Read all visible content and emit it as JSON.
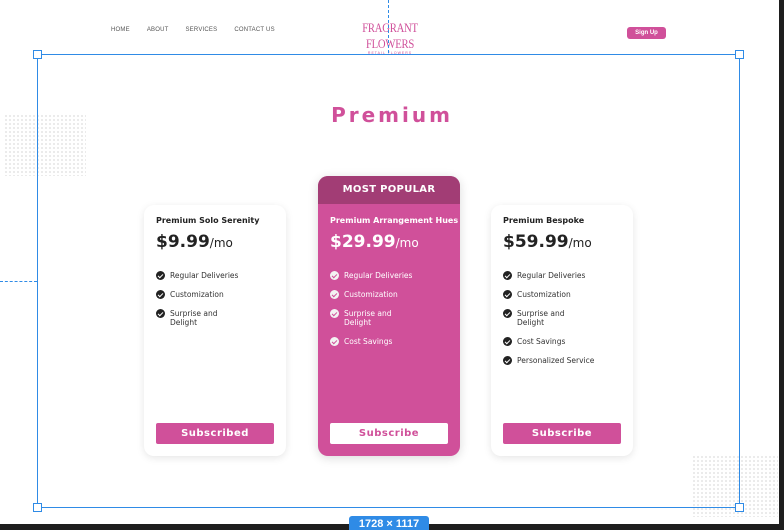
{
  "nav": {
    "items": [
      "HOME",
      "ABOUT",
      "SERVICES",
      "CONTACT US"
    ],
    "logo_main": "FRAGRANT FLOWERS",
    "logo_sub": "RETAIL FLOWERS",
    "signup_label": "Sign Up"
  },
  "canvas": {
    "dimension_label": "1728 × 1117"
  },
  "pricing": {
    "title": "Premium",
    "plans": [
      {
        "name": "Premium Solo Serenity",
        "price": "$9.99",
        "period": "/mo",
        "features": [
          "Regular Deliveries",
          "Customization",
          "Surprise and\nDelight"
        ],
        "button": "Subscribed",
        "featured": false
      },
      {
        "badge": "MOST POPULAR",
        "name": "Premium Arrangement Hues",
        "price": "$29.99",
        "period": "/mo",
        "features": [
          "Regular Deliveries",
          "Customization",
          "Surprise and\nDelight",
          "Cost Savings"
        ],
        "button": "Subscribe",
        "featured": true
      },
      {
        "name": "Premium Bespoke",
        "price": "$59.99",
        "period": "/mo",
        "features": [
          "Regular Deliveries",
          "Customization",
          "Surprise and\nDelight",
          "Cost Savings",
          "Personalized Service"
        ],
        "button": "Subscribe",
        "featured": false
      }
    ]
  },
  "colors": {
    "accent": "#d0509a",
    "badge": "#a23d75",
    "selection": "#2f8be6"
  }
}
